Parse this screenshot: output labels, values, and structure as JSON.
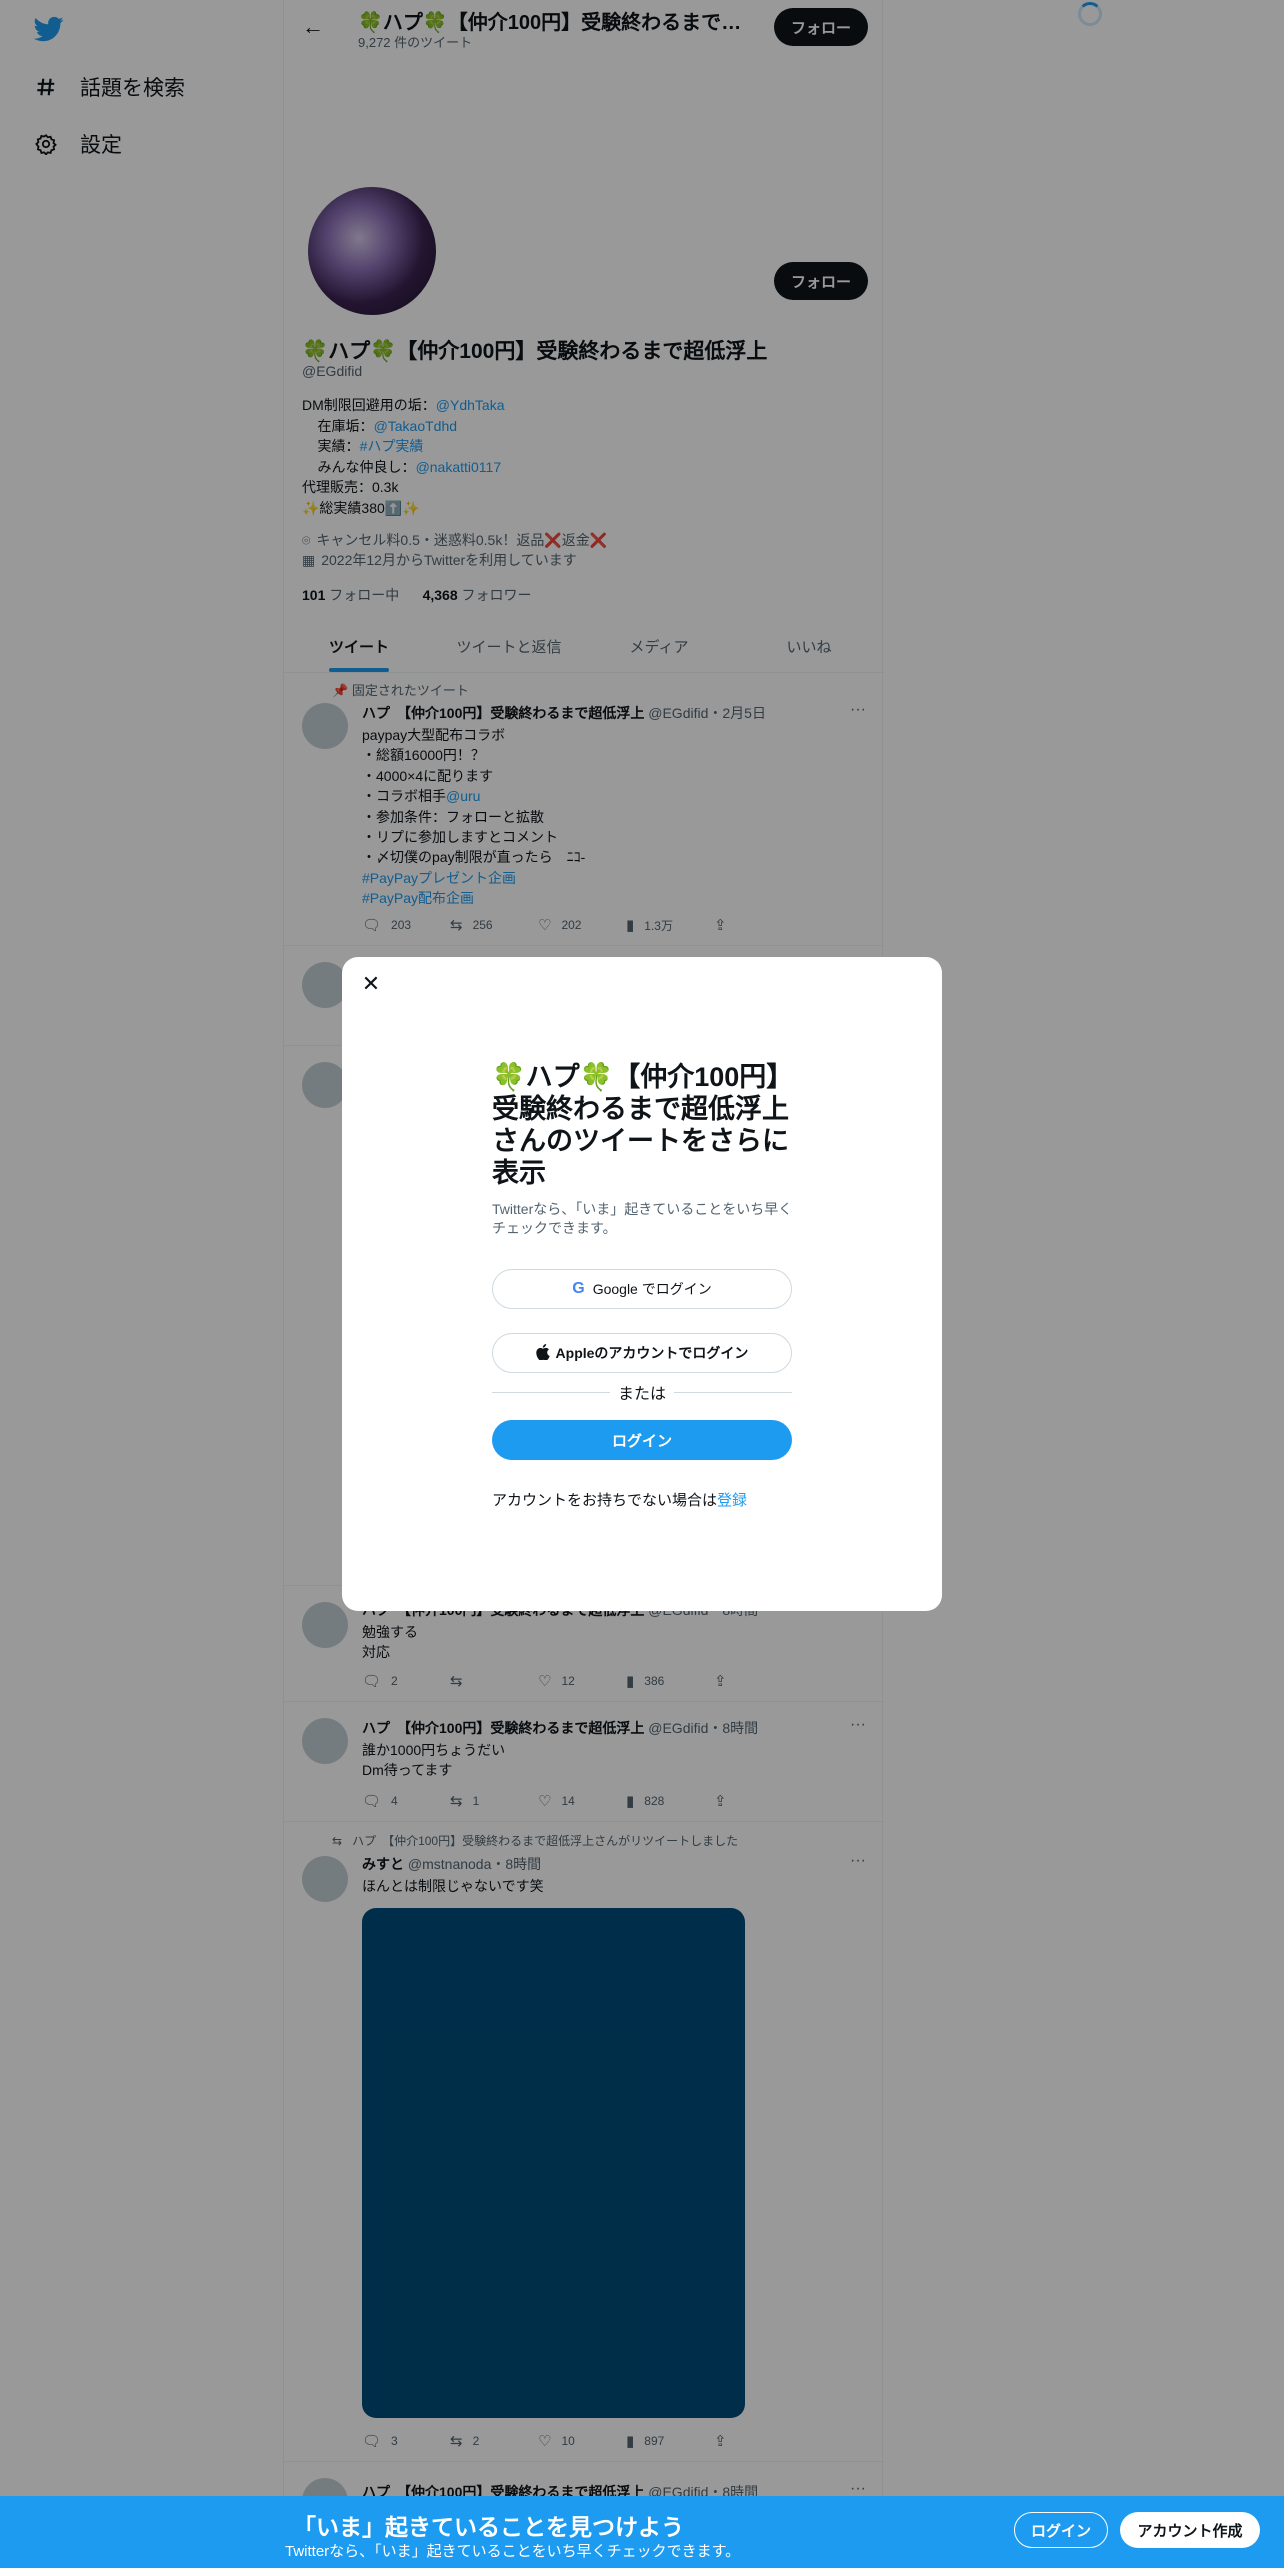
{
  "nav": {
    "items": [
      {
        "label": "話題を検索",
        "icon": "hashtag-icon"
      },
      {
        "label": "設定",
        "icon": "gear-icon"
      }
    ]
  },
  "header": {
    "title": "🍀ハプ🍀【仲介100円】受験終わるまで超低浮上",
    "tweet_count": "9,272 件のツイート",
    "follow_label": "フォロー"
  },
  "profile": {
    "name": "🍀ハプ🍀【仲介100円】受験終わるまで超低浮上",
    "handle": "@EGdifid",
    "follow_label": "フォロー",
    "bio": {
      "l1_text": "DM制限回避用の垢：",
      "l1_link": "@YdhTaka",
      "l2_text": "    在庫垢：",
      "l2_link": "@TakaoTdhd",
      "l3_text": "    実績：",
      "l3_link": "#ハプ実績",
      "l4_text": "    みんな仲良し：",
      "l4_link": "@nakatti0117",
      "l5": "代理販売：0.3k",
      "l6": "✨総実績380⬆️✨"
    },
    "location": "キャンセル料0.5・迷惑料0.5k！返品❌返金❌",
    "joined": "2022年12月からTwitterを利用しています",
    "following_count": "101",
    "following_label": "フォロー中",
    "followers_count": "4,368",
    "followers_label": "フォロワー"
  },
  "tabs": [
    "ツイート",
    "ツイートと返信",
    "メディア",
    "いいね"
  ],
  "pinned_label": "固定されたツイート",
  "tweets": [
    {
      "name": "ハプ　【仲介100円】受験終わるまで超低浮上",
      "meta": "@EGdifid・2月5日",
      "body": "paypay大型配布コラボ\n・総額16000円！？\n・4000×4に配ります\n・コラボ相手",
      "mention": "@uru",
      "body2": "・参加条件：フォローと拡散\n・リプに参加しますとコメント\n・〆切僕のpay制限が直ったら　ﾆｺ-",
      "tag1": "#PayPayプレゼント企画",
      "tag2": "#PayPay配布企画",
      "replies": "203",
      "retweets": "256",
      "likes": "202",
      "views": "1.3万"
    },
    {
      "name": "ハプ　【仲介100円】受験終わるまで超低浮上",
      "meta": "@EGdifid・8時間",
      "body": "勉強する\n対応",
      "replies": "2",
      "retweets": "",
      "likes": "12",
      "views": "386"
    },
    {
      "name": "ハプ　【仲介100円】受験終わるまで超低浮上",
      "meta": "@EGdifid・8時間",
      "body": "誰か1000円ちょうだい\nDm待ってます",
      "replies": "4",
      "retweets": "1",
      "likes": "14",
      "views": "828"
    },
    {
      "retweet_note": "ハプ　【仲介100円】受験終わるまで超低浮上さんがリツイートしました",
      "name": "みすと",
      "meta": "@mstnanoda・8時間",
      "body": "ほんとは制限じゃないです笑",
      "replies": "3",
      "retweets": "2",
      "likes": "10",
      "views": "897"
    },
    {
      "name": "ハプ　【仲介100円】受験終わるまで超低浮上",
      "meta": "@EGdifid・8時間"
    }
  ],
  "modal": {
    "title": "🍀ハプ🍀【仲介100円】受験終わるまで超低浮上さんのツイートをさらに表示",
    "subtitle": "Twitterなら、「いま」起きていることをいち早くチェックできます。",
    "google_label": "Google でログイン",
    "apple_label": "Appleのアカウントでログイン",
    "or_label": "または",
    "login_label": "ログイン",
    "signup_prompt": "アカウントをお持ちでない場合は",
    "signup_link": "登録"
  },
  "bottom_bar": {
    "title": "「いま」起きていることを見つけよう",
    "subtitle": "Twitterなら、「いま」起きていることをいち早くチェックできます。",
    "login_label": "ログイン",
    "signup_label": "アカウント作成"
  },
  "colors": {
    "accent": "#1d9bf0",
    "text": "#0f1419",
    "muted": "#536471",
    "media": "#004c7a"
  }
}
